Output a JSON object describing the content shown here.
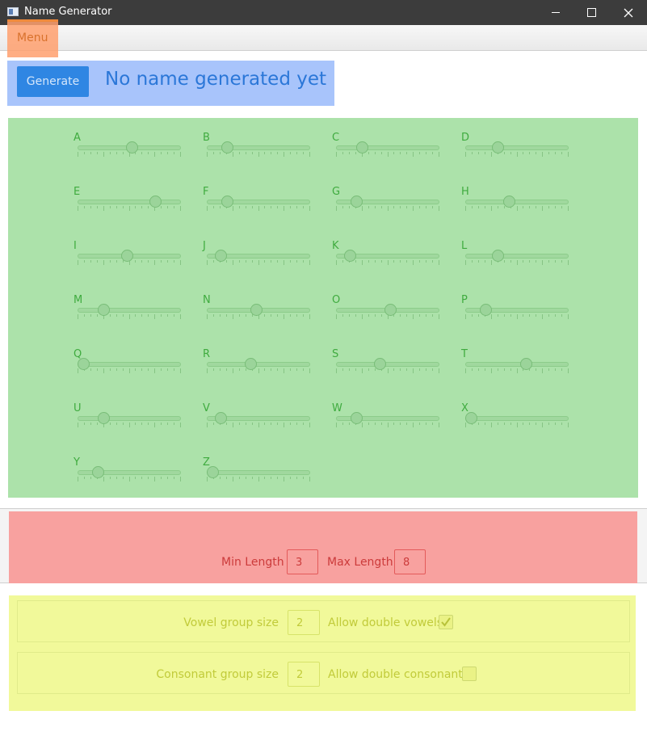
{
  "window": {
    "title": "Name Generator"
  },
  "menu": {
    "label": "Menu"
  },
  "generator": {
    "button_label": "Generate",
    "result": "No name generated yet"
  },
  "letters": [
    {
      "label": "A",
      "value": 0.53
    },
    {
      "label": "B",
      "value": 0.16
    },
    {
      "label": "C",
      "value": 0.22
    },
    {
      "label": "D",
      "value": 0.29
    },
    {
      "label": "E",
      "value": 0.78
    },
    {
      "label": "F",
      "value": 0.16
    },
    {
      "label": "G",
      "value": 0.16
    },
    {
      "label": "H",
      "value": 0.41
    },
    {
      "label": "I",
      "value": 0.47
    },
    {
      "label": "J",
      "value": 0.09
    },
    {
      "label": "K",
      "value": 0.09
    },
    {
      "label": "L",
      "value": 0.29
    },
    {
      "label": "M",
      "value": 0.22
    },
    {
      "label": "N",
      "value": 0.47
    },
    {
      "label": "O",
      "value": 0.53
    },
    {
      "label": "P",
      "value": 0.16
    },
    {
      "label": "Q",
      "value": 0.0
    },
    {
      "label": "R",
      "value": 0.41
    },
    {
      "label": "S",
      "value": 0.41
    },
    {
      "label": "T",
      "value": 0.6
    },
    {
      "label": "U",
      "value": 0.22
    },
    {
      "label": "V",
      "value": 0.09
    },
    {
      "label": "W",
      "value": 0.16
    },
    {
      "label": "X",
      "value": 0.0
    },
    {
      "label": "Y",
      "value": 0.16
    },
    {
      "label": "Z",
      "value": 0.0
    }
  ],
  "length": {
    "min_label": "Min Length",
    "min_value": "3",
    "max_label": "Max Length",
    "max_value": "8"
  },
  "vowel": {
    "group_label": "Vowel group size",
    "group_value": "2",
    "double_label": "Allow double vowels",
    "double_checked": true
  },
  "consonant": {
    "group_label": "Consonant group size",
    "group_value": "2",
    "double_label": "Allow double consonants",
    "double_checked": false
  },
  "colors": {
    "blue_panel": "#a8c4fb",
    "green_panel": "#ace2aa",
    "red_panel": "#f8a19f",
    "yellow_panel": "#f1f99a",
    "accent": "#2f86e3"
  }
}
